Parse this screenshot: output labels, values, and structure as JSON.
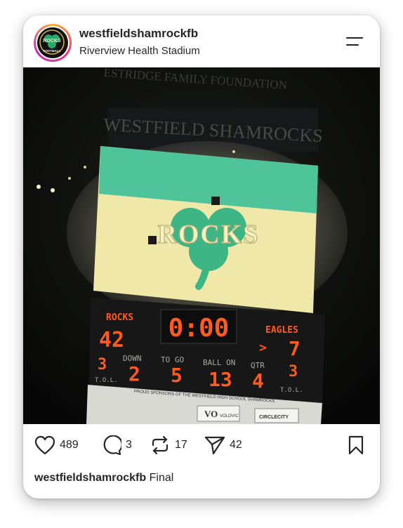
{
  "post": {
    "username": "westfieldshamrockfb",
    "location": "Riverview Health Stadium",
    "avatar_text_top": "ROCKS",
    "avatar_text_bottom": "FOOTBALL"
  },
  "photo": {
    "sign_top": "ESTRIDGE FAMILY FOUNDATION",
    "sign_main": "WESTFIELD SHAMROCKS",
    "board_logo_text": "ROCKS",
    "home_label": "ROCKS",
    "home_score": "42",
    "clock": "0:00",
    "away_label": "EAGLES",
    "away_score": "7",
    "possession_arrow": ">",
    "home_tol": "3",
    "home_tol_label": "T.O.L.",
    "down_label": "DOWN",
    "down": "2",
    "togo_label": "TO GO",
    "togo": "5",
    "ballon_label": "BALL ON",
    "ballon": "13",
    "qtr_label": "QTR",
    "qtr": "4",
    "away_tol": "3",
    "away_tol_label": "T.O.L.",
    "sponsor_banner": "PROUD SPONSORS OF THE WESTFIELD HIGH SCHOOL SHAMROCKS",
    "sponsor_1": "VO",
    "sponsor_1_name": "VOLOVIC",
    "sponsor_2": "CIRCLECITY"
  },
  "actions": {
    "likes": "489",
    "comments": "3",
    "reposts": "17",
    "shares": "42"
  },
  "caption": {
    "username": "westfieldshamrockfb",
    "text": "Final"
  },
  "colors": {
    "board_teal": "#4fc39a",
    "board_cream": "#f0e8a8",
    "led": "#ff5a1f"
  }
}
